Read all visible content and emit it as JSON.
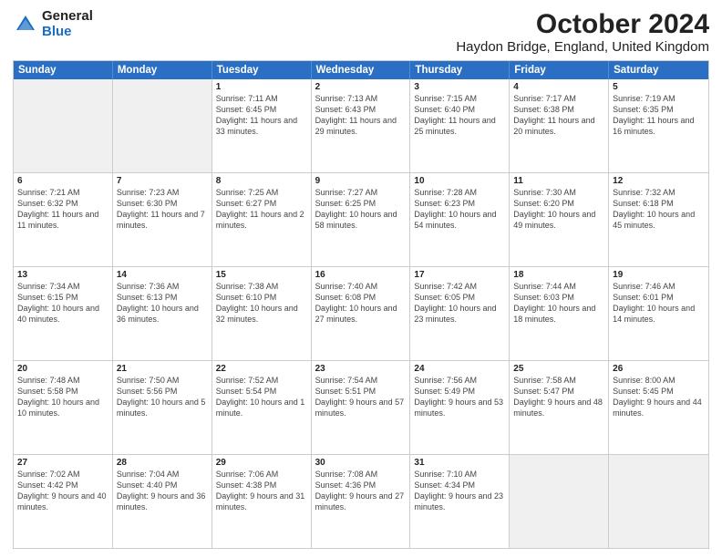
{
  "header": {
    "logo_general": "General",
    "logo_blue": "Blue",
    "title": "October 2024",
    "location": "Haydon Bridge, England, United Kingdom"
  },
  "days_of_week": [
    "Sunday",
    "Monday",
    "Tuesday",
    "Wednesday",
    "Thursday",
    "Friday",
    "Saturday"
  ],
  "weeks": [
    [
      {
        "day": "",
        "sunrise": "",
        "sunset": "",
        "daylight": ""
      },
      {
        "day": "",
        "sunrise": "",
        "sunset": "",
        "daylight": ""
      },
      {
        "day": "1",
        "sunrise": "Sunrise: 7:11 AM",
        "sunset": "Sunset: 6:45 PM",
        "daylight": "Daylight: 11 hours and 33 minutes."
      },
      {
        "day": "2",
        "sunrise": "Sunrise: 7:13 AM",
        "sunset": "Sunset: 6:43 PM",
        "daylight": "Daylight: 11 hours and 29 minutes."
      },
      {
        "day": "3",
        "sunrise": "Sunrise: 7:15 AM",
        "sunset": "Sunset: 6:40 PM",
        "daylight": "Daylight: 11 hours and 25 minutes."
      },
      {
        "day": "4",
        "sunrise": "Sunrise: 7:17 AM",
        "sunset": "Sunset: 6:38 PM",
        "daylight": "Daylight: 11 hours and 20 minutes."
      },
      {
        "day": "5",
        "sunrise": "Sunrise: 7:19 AM",
        "sunset": "Sunset: 6:35 PM",
        "daylight": "Daylight: 11 hours and 16 minutes."
      }
    ],
    [
      {
        "day": "6",
        "sunrise": "Sunrise: 7:21 AM",
        "sunset": "Sunset: 6:32 PM",
        "daylight": "Daylight: 11 hours and 11 minutes."
      },
      {
        "day": "7",
        "sunrise": "Sunrise: 7:23 AM",
        "sunset": "Sunset: 6:30 PM",
        "daylight": "Daylight: 11 hours and 7 minutes."
      },
      {
        "day": "8",
        "sunrise": "Sunrise: 7:25 AM",
        "sunset": "Sunset: 6:27 PM",
        "daylight": "Daylight: 11 hours and 2 minutes."
      },
      {
        "day": "9",
        "sunrise": "Sunrise: 7:27 AM",
        "sunset": "Sunset: 6:25 PM",
        "daylight": "Daylight: 10 hours and 58 minutes."
      },
      {
        "day": "10",
        "sunrise": "Sunrise: 7:28 AM",
        "sunset": "Sunset: 6:23 PM",
        "daylight": "Daylight: 10 hours and 54 minutes."
      },
      {
        "day": "11",
        "sunrise": "Sunrise: 7:30 AM",
        "sunset": "Sunset: 6:20 PM",
        "daylight": "Daylight: 10 hours and 49 minutes."
      },
      {
        "day": "12",
        "sunrise": "Sunrise: 7:32 AM",
        "sunset": "Sunset: 6:18 PM",
        "daylight": "Daylight: 10 hours and 45 minutes."
      }
    ],
    [
      {
        "day": "13",
        "sunrise": "Sunrise: 7:34 AM",
        "sunset": "Sunset: 6:15 PM",
        "daylight": "Daylight: 10 hours and 40 minutes."
      },
      {
        "day": "14",
        "sunrise": "Sunrise: 7:36 AM",
        "sunset": "Sunset: 6:13 PM",
        "daylight": "Daylight: 10 hours and 36 minutes."
      },
      {
        "day": "15",
        "sunrise": "Sunrise: 7:38 AM",
        "sunset": "Sunset: 6:10 PM",
        "daylight": "Daylight: 10 hours and 32 minutes."
      },
      {
        "day": "16",
        "sunrise": "Sunrise: 7:40 AM",
        "sunset": "Sunset: 6:08 PM",
        "daylight": "Daylight: 10 hours and 27 minutes."
      },
      {
        "day": "17",
        "sunrise": "Sunrise: 7:42 AM",
        "sunset": "Sunset: 6:05 PM",
        "daylight": "Daylight: 10 hours and 23 minutes."
      },
      {
        "day": "18",
        "sunrise": "Sunrise: 7:44 AM",
        "sunset": "Sunset: 6:03 PM",
        "daylight": "Daylight: 10 hours and 18 minutes."
      },
      {
        "day": "19",
        "sunrise": "Sunrise: 7:46 AM",
        "sunset": "Sunset: 6:01 PM",
        "daylight": "Daylight: 10 hours and 14 minutes."
      }
    ],
    [
      {
        "day": "20",
        "sunrise": "Sunrise: 7:48 AM",
        "sunset": "Sunset: 5:58 PM",
        "daylight": "Daylight: 10 hours and 10 minutes."
      },
      {
        "day": "21",
        "sunrise": "Sunrise: 7:50 AM",
        "sunset": "Sunset: 5:56 PM",
        "daylight": "Daylight: 10 hours and 5 minutes."
      },
      {
        "day": "22",
        "sunrise": "Sunrise: 7:52 AM",
        "sunset": "Sunset: 5:54 PM",
        "daylight": "Daylight: 10 hours and 1 minute."
      },
      {
        "day": "23",
        "sunrise": "Sunrise: 7:54 AM",
        "sunset": "Sunset: 5:51 PM",
        "daylight": "Daylight: 9 hours and 57 minutes."
      },
      {
        "day": "24",
        "sunrise": "Sunrise: 7:56 AM",
        "sunset": "Sunset: 5:49 PM",
        "daylight": "Daylight: 9 hours and 53 minutes."
      },
      {
        "day": "25",
        "sunrise": "Sunrise: 7:58 AM",
        "sunset": "Sunset: 5:47 PM",
        "daylight": "Daylight: 9 hours and 48 minutes."
      },
      {
        "day": "26",
        "sunrise": "Sunrise: 8:00 AM",
        "sunset": "Sunset: 5:45 PM",
        "daylight": "Daylight: 9 hours and 44 minutes."
      }
    ],
    [
      {
        "day": "27",
        "sunrise": "Sunrise: 7:02 AM",
        "sunset": "Sunset: 4:42 PM",
        "daylight": "Daylight: 9 hours and 40 minutes."
      },
      {
        "day": "28",
        "sunrise": "Sunrise: 7:04 AM",
        "sunset": "Sunset: 4:40 PM",
        "daylight": "Daylight: 9 hours and 36 minutes."
      },
      {
        "day": "29",
        "sunrise": "Sunrise: 7:06 AM",
        "sunset": "Sunset: 4:38 PM",
        "daylight": "Daylight: 9 hours and 31 minutes."
      },
      {
        "day": "30",
        "sunrise": "Sunrise: 7:08 AM",
        "sunset": "Sunset: 4:36 PM",
        "daylight": "Daylight: 9 hours and 27 minutes."
      },
      {
        "day": "31",
        "sunrise": "Sunrise: 7:10 AM",
        "sunset": "Sunset: 4:34 PM",
        "daylight": "Daylight: 9 hours and 23 minutes."
      },
      {
        "day": "",
        "sunrise": "",
        "sunset": "",
        "daylight": ""
      },
      {
        "day": "",
        "sunrise": "",
        "sunset": "",
        "daylight": ""
      }
    ]
  ]
}
